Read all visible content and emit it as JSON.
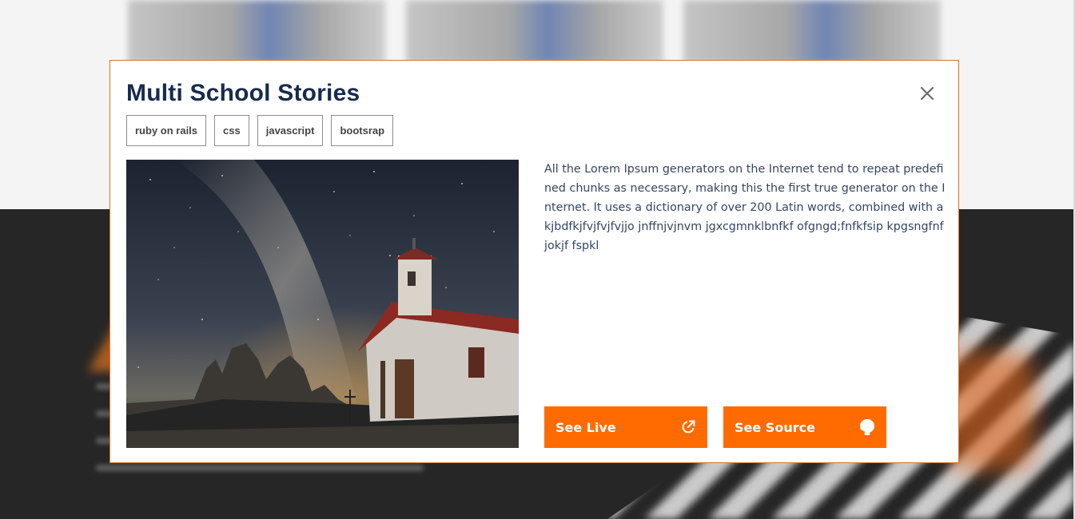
{
  "modal": {
    "title": "Multi School Stories",
    "tags": [
      "ruby on rails",
      "css",
      "javascript",
      "bootsrap"
    ],
    "description": "All the Lorem Ipsum generators on the Internet tend to repeat predefined chunks as necessary, making this the first true generator on the Internet. It uses a dictionary of over 200 Latin words, combined with a kjbdfkjfvjfvjfvjjo jnffnjvjnvm jgxcgmnklbnfkf ofgngd;fnfkfsip kpgsngfnfjokjf fspkl",
    "see_live_label": "See Live",
    "see_source_label": "See Source",
    "close_icon": "close-icon",
    "live_icon": "external-link-icon",
    "source_icon": "github-icon"
  },
  "colors": {
    "accent": "#ff6b00",
    "modal_border": "#e0731f",
    "title": "#172b4d",
    "body_text": "#344563"
  }
}
